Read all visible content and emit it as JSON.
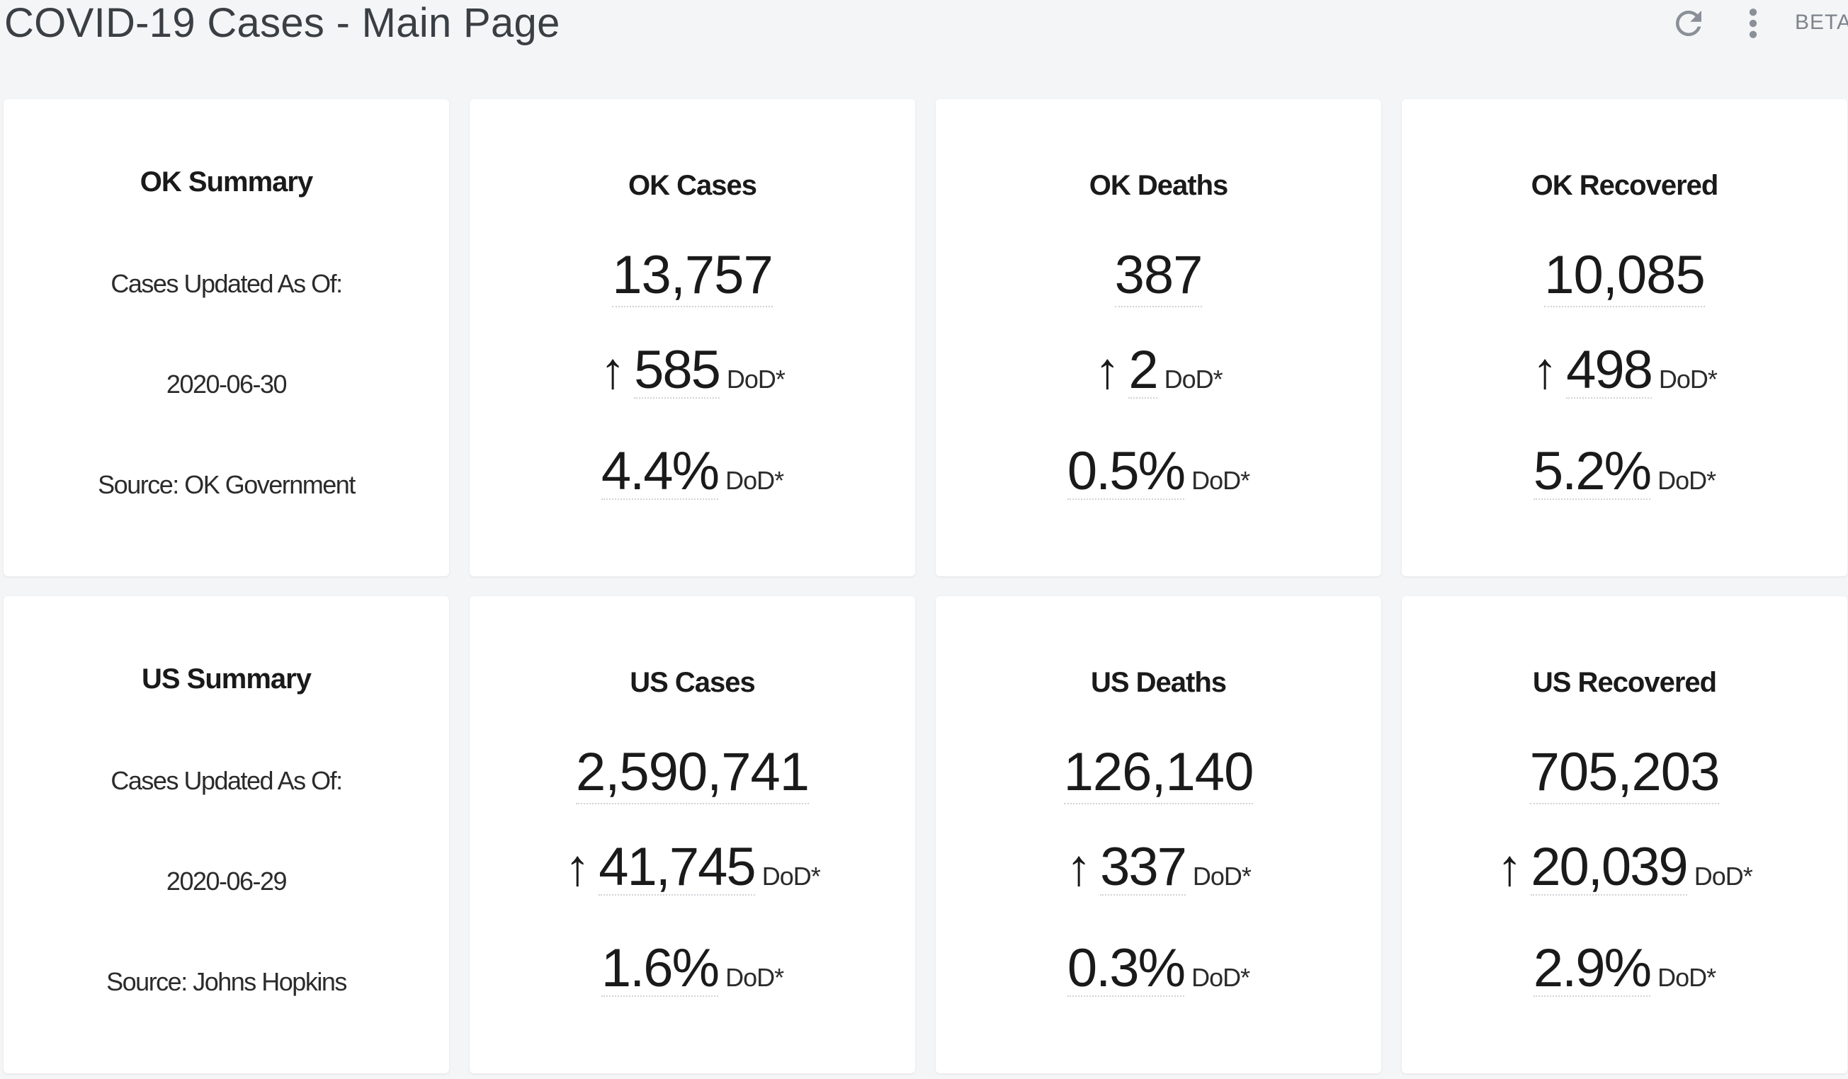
{
  "header": {
    "title": "COVID-19 Cases - Main Page",
    "refresh_icon": "refresh-icon",
    "more_icon": "more-vert-icon",
    "beta_label": "BETA",
    "icon_color": "#8a9097"
  },
  "ok": {
    "summary": {
      "title": "OK Summary",
      "updated_label": "Cases Updated As Of:",
      "date": "2020-06-30",
      "source": "Source: OK Government"
    },
    "cases": {
      "title": "OK Cases",
      "value": "13,757",
      "arrow": "↑",
      "delta": "585",
      "delta_unit": "DoD*",
      "pct": "4.4%",
      "pct_unit": "DoD*"
    },
    "deaths": {
      "title": "OK Deaths",
      "value": "387",
      "arrow": "↑",
      "delta": "2",
      "delta_unit": "DoD*",
      "pct": "0.5%",
      "pct_unit": "DoD*"
    },
    "recovered": {
      "title": "OK Recovered",
      "value": "10,085",
      "arrow": "↑",
      "delta": "498",
      "delta_unit": "DoD*",
      "pct": "5.2%",
      "pct_unit": "DoD*"
    }
  },
  "us": {
    "summary": {
      "title": "US Summary",
      "updated_label": "Cases Updated As Of:",
      "date": "2020-06-29",
      "source": "Source: Johns Hopkins"
    },
    "cases": {
      "title": "US Cases",
      "value": "2,590,741",
      "arrow": "↑",
      "delta": "41,745",
      "delta_unit": "DoD*",
      "pct": "1.6%",
      "pct_unit": "DoD*"
    },
    "deaths": {
      "title": "US Deaths",
      "value": "126,140",
      "arrow": "↑",
      "delta": "337",
      "delta_unit": "DoD*",
      "pct": "0.3%",
      "pct_unit": "DoD*"
    },
    "recovered": {
      "title": "US Recovered",
      "value": "705,203",
      "arrow": "↑",
      "delta": "20,039",
      "delta_unit": "DoD*",
      "pct": "2.9%",
      "pct_unit": "DoD*"
    }
  }
}
